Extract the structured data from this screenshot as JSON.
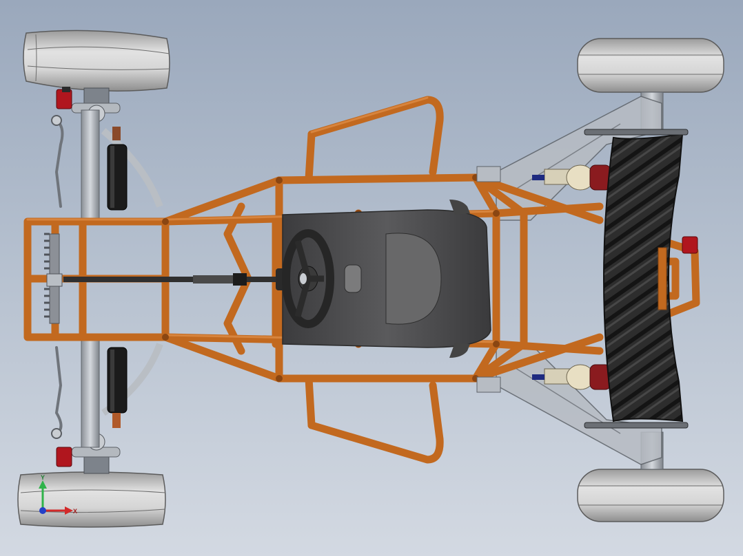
{
  "app": {
    "title": ""
  },
  "viewport": {
    "background_top": "#9aa8bc",
    "background_bottom": "#d3d9e2"
  },
  "model": {
    "frame_color": "#c2691f",
    "frame_dark": "#8a4612",
    "tire_color": "#c8c8c8",
    "metal_color": "#a7adb5",
    "shock_color": "#1b1b1b",
    "caliper_color": "#b0161e",
    "seat_color": "#4d4d4f",
    "cvt_color": "#2a2a2a"
  },
  "triad": {
    "y_label": "Y",
    "x_label": "X",
    "y_color": "#2fb34a",
    "x_color": "#d32a2a",
    "z_color": "#2440c8"
  }
}
